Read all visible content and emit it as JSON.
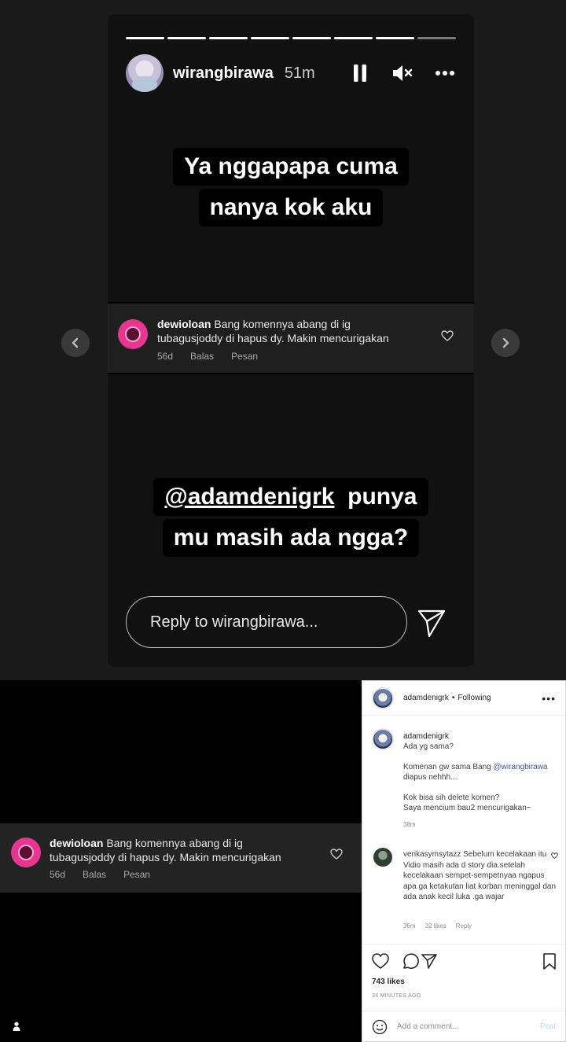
{
  "story": {
    "username": "wirangbirawa",
    "time": "51m",
    "caption1": [
      "Ya nggapapa cuma",
      "nanya kok aku"
    ],
    "caption2_mention": "@adamdenigrk",
    "caption2_rest1": "punya",
    "caption2_line2": "mu masih ada ngga?",
    "reply_placeholder": "Reply to wirangbirawa..."
  },
  "comment": {
    "user": "dewioloan",
    "text": "Bang komennya abang di ig",
    "text2": "tubagusjoddy di hapus dy. Makin mencurigakan",
    "age": "56d",
    "reply": "Balas",
    "message": "Pesan"
  },
  "post": {
    "user": "adamdenigrk",
    "dot": "•",
    "following": "Following",
    "caption_user": "adamdenigrk",
    "caption_lines": [
      "Ada yg sama?",
      "",
      "Komenan gw sama Bang",
      "diapus nehhh...",
      "",
      "Kok bisa sih delete komen?",
      "Saya mencium bau2 mencurigakan~"
    ],
    "mention": "@wirangbirawa",
    "caption_age": "38m",
    "comment2_user": "verikasymsytazz",
    "comment2_text": "Sebelum kecelakaan itu Vidio masih ada d story dia.setelah kecelakaan sempet-sempetnyaa ngapus apa ga ketakutan liat korban meninggal dan ada anak kecil luka .ga wajar",
    "comment2_age": "36m",
    "comment2_likes": "32 likes",
    "comment2_reply": "Reply",
    "likes": "743 likes",
    "ago": "38 MINUTES AGO",
    "add_comment": "Add a comment...",
    "post_btn": "Post"
  },
  "icons": {
    "pause": "pause-icon",
    "mute": "mute-icon",
    "more": "more-icon",
    "send": "send-icon",
    "heart": "heart-icon",
    "prev": "chevron-left-icon",
    "next": "chevron-right-icon"
  }
}
